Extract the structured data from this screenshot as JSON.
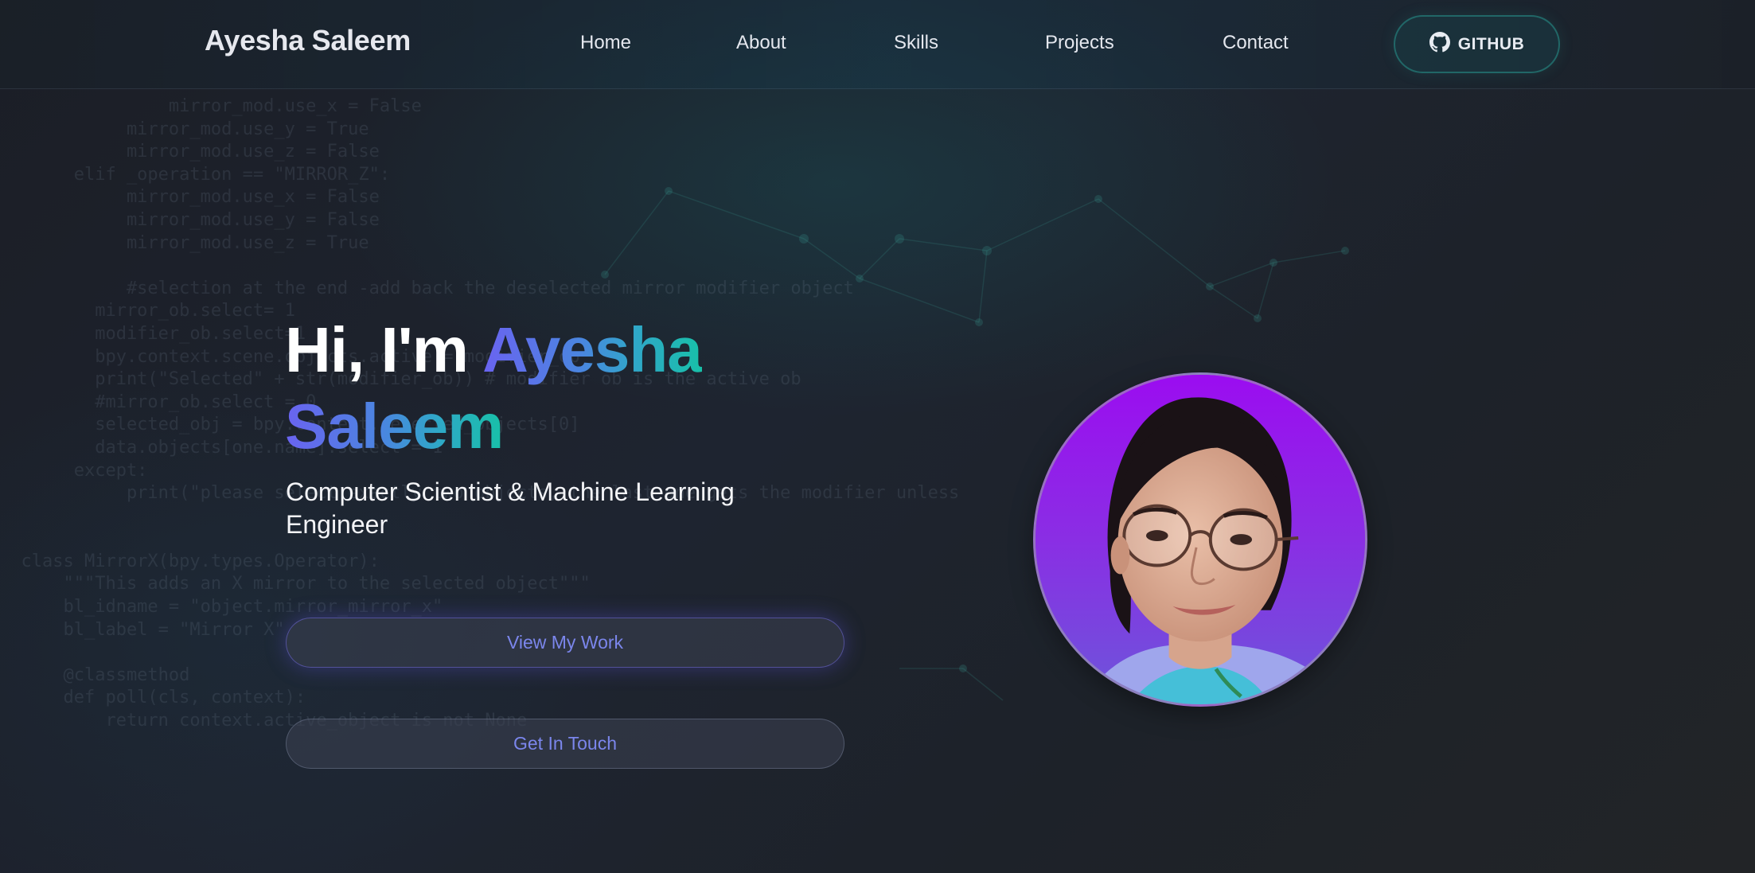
{
  "header": {
    "brand": "Ayesha Saleem",
    "nav": [
      {
        "label": "Home"
      },
      {
        "label": "About"
      },
      {
        "label": "Skills"
      },
      {
        "label": "Projects"
      },
      {
        "label": "Contact"
      }
    ],
    "github_label": "GITHUB",
    "github_icon": "github-icon"
  },
  "hero": {
    "greeting": "Hi, I'm",
    "name_first": "Ayesha",
    "name_last": "Saleem",
    "subtitle": "Computer Scientist & Machine Learning Engineer",
    "primary_button": "View My Work",
    "secondary_button": "Get In Touch",
    "profile_photo": "profile-photo"
  },
  "colors": {
    "background": "#1c1f27",
    "accent_gradient_start": "#6a63f0",
    "accent_gradient_end": "#18c0a8",
    "button_text": "#7b86ec",
    "github_border": "#2a968c",
    "avatar_bg": "#9a10ee"
  }
}
